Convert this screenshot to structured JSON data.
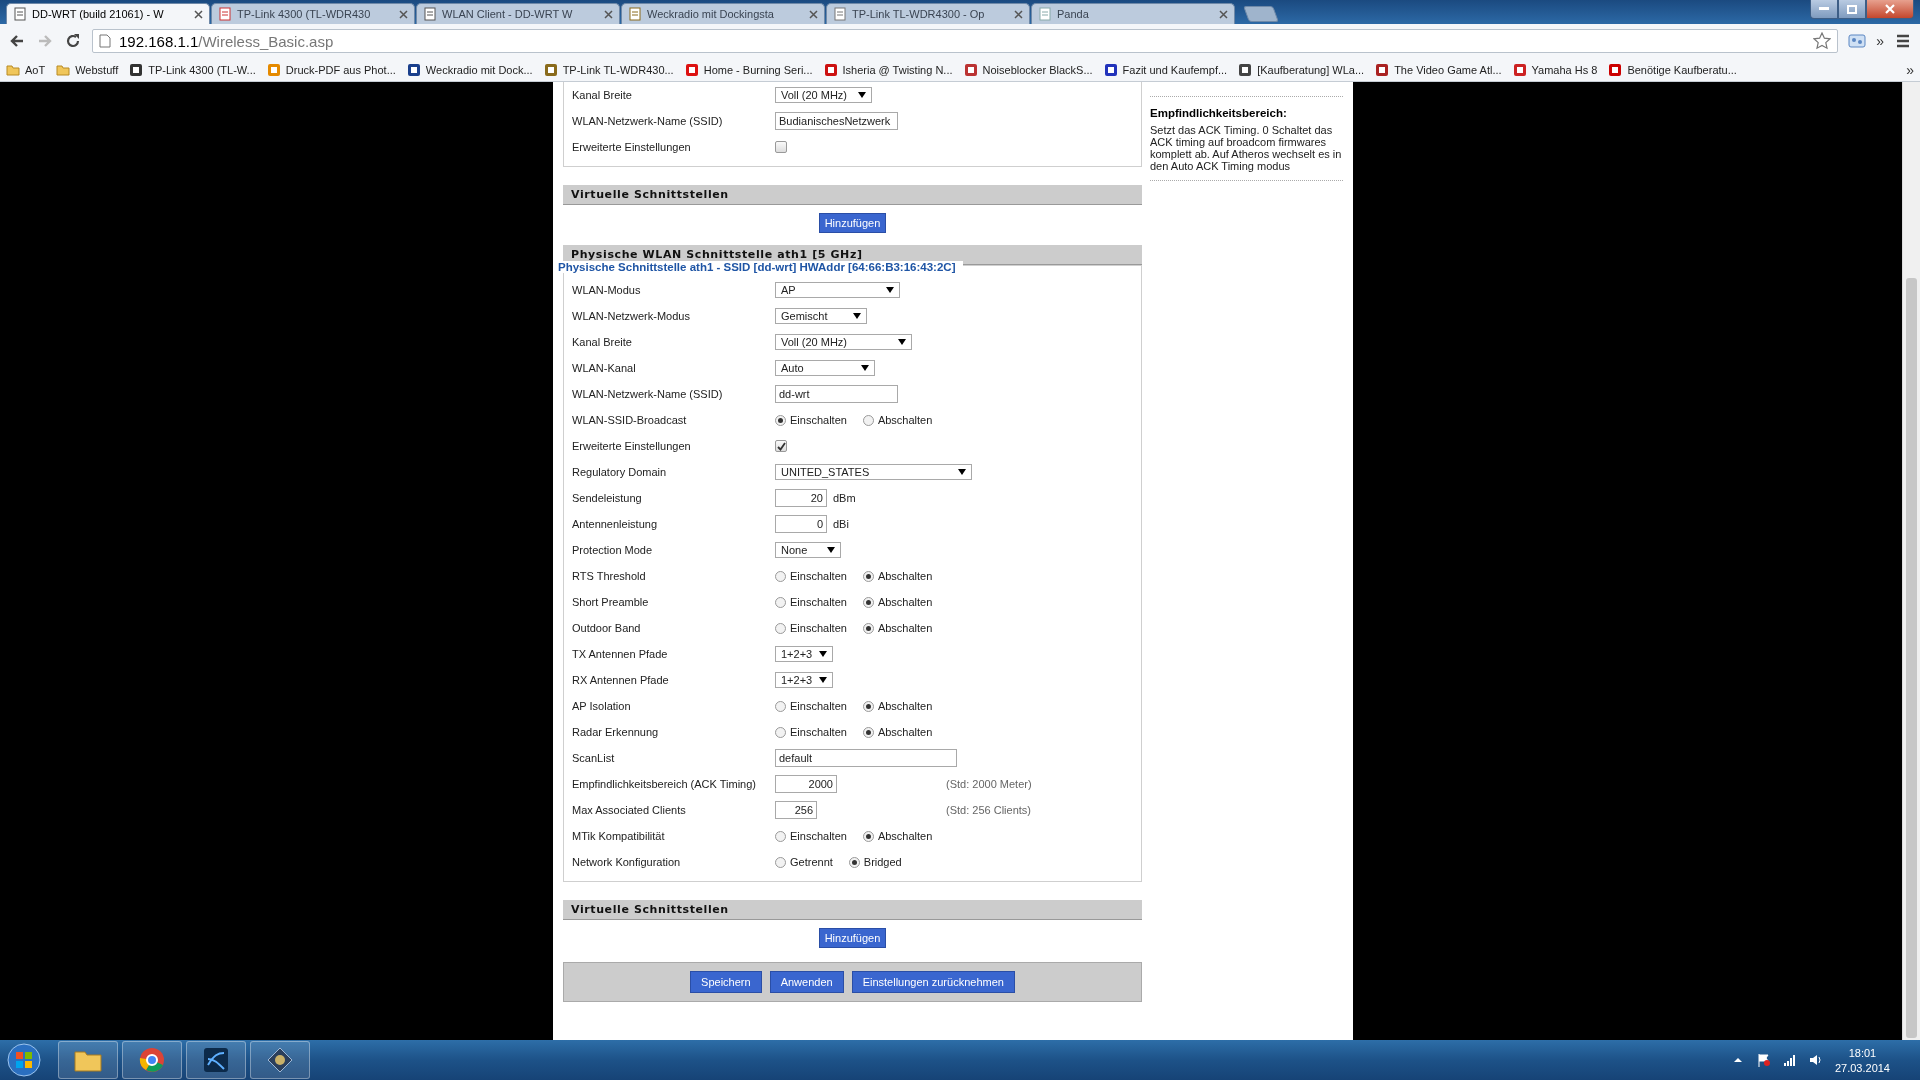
{
  "browser": {
    "tabs": [
      {
        "title": "DD-WRT (build 21061) - W",
        "selected": true
      },
      {
        "title": "TP-Link 4300 (TL-WDR430",
        "selected": false
      },
      {
        "title": "WLAN Client - DD-WRT W",
        "selected": false
      },
      {
        "title": "Weckradio mit Dockingsta",
        "selected": false
      },
      {
        "title": "TP-Link TL-WDR4300 - Op",
        "selected": false
      },
      {
        "title": "Panda",
        "selected": false
      }
    ],
    "address": {
      "host": "192.168.1.1",
      "path": "/Wireless_Basic.asp"
    },
    "toolbar_more": "»",
    "bookmarks": [
      {
        "label": "AoT",
        "kind": "folder"
      },
      {
        "label": "Webstuff",
        "kind": "folder"
      },
      {
        "label": "TP-Link 4300 (TL-W...",
        "kind": "site"
      },
      {
        "label": "Druck-PDF aus Phot...",
        "kind": "site"
      },
      {
        "label": "Weckradio mit Dock...",
        "kind": "site"
      },
      {
        "label": "TP-Link TL-WDR430...",
        "kind": "site"
      },
      {
        "label": "Home - Burning Seri...",
        "kind": "site"
      },
      {
        "label": "Isheria @ Twisting N...",
        "kind": "site"
      },
      {
        "label": "Noiseblocker BlackS...",
        "kind": "site"
      },
      {
        "label": "Fazit und Kaufempf...",
        "kind": "site"
      },
      {
        "label": "[Kaufberatung] WLa...",
        "kind": "site"
      },
      {
        "label": "The Video Game Atl...",
        "kind": "site"
      },
      {
        "label": "Yamaha Hs 8",
        "kind": "site"
      },
      {
        "label": "Benötige Kaufberatu...",
        "kind": "site"
      }
    ],
    "bookmarks_more": "»"
  },
  "content": [
    {
      "kind": "fieldset",
      "rows": [
        {
          "label": "Kanal Breite",
          "kind": "select",
          "value": "Voll (20 MHz)"
        },
        {
          "label": "WLAN-Netzwerk-Name (SSID)",
          "kind": "text",
          "value": "BudianischesNetzwerk"
        },
        {
          "label": "Erweiterte Einstellungen",
          "kind": "checkbox",
          "checked": false
        }
      ]
    },
    {
      "kind": "header",
      "title": "Virtuelle Schnittstellen"
    },
    {
      "kind": "add",
      "label": "Hinzufügen"
    },
    {
      "kind": "header",
      "title": "Physische WLAN Schnittstelle ath1 [5 GHz]"
    },
    {
      "kind": "fieldset",
      "legend": "Physische Schnittstelle ath1 - SSID [dd-wrt] HWAddr [64:66:B3:16:43:2C]",
      "rows": [
        {
          "label": "WLAN-Modus",
          "kind": "select",
          "value": "AP"
        },
        {
          "label": "WLAN-Netzwerk-Modus",
          "kind": "select",
          "value": "Gemischt"
        },
        {
          "label": "Kanal Breite",
          "kind": "select",
          "value": "Voll (20 MHz)"
        },
        {
          "label": "WLAN-Kanal",
          "kind": "select",
          "value": "Auto"
        },
        {
          "label": "WLAN-Netzwerk-Name (SSID)",
          "kind": "text",
          "value": "dd-wrt"
        },
        {
          "label": "WLAN-SSID-Broadcast",
          "kind": "radio",
          "options": [
            {
              "label": "Einschalten",
              "selected": true
            },
            {
              "label": "Abschalten",
              "selected": false
            }
          ]
        },
        {
          "label": "Erweiterte Einstellungen",
          "kind": "checkbox",
          "checked": true
        },
        {
          "label": "Regulatory Domain",
          "kind": "select",
          "value": "UNITED_STATES"
        },
        {
          "label": "Sendeleistung",
          "kind": "number",
          "value": "20",
          "unit": "dBm"
        },
        {
          "label": "Antennenleistung",
          "kind": "number",
          "value": "0",
          "unit": "dBi"
        },
        {
          "label": "Protection Mode",
          "kind": "select",
          "value": "None"
        },
        {
          "label": "RTS Threshold",
          "kind": "radio",
          "options": [
            {
              "label": "Einschalten",
              "selected": false
            },
            {
              "label": "Abschalten",
              "selected": true
            }
          ]
        },
        {
          "label": "Short Preamble",
          "kind": "radio",
          "options": [
            {
              "label": "Einschalten",
              "selected": false
            },
            {
              "label": "Abschalten",
              "selected": true
            }
          ]
        },
        {
          "label": "Outdoor Band",
          "kind": "radio",
          "options": [
            {
              "label": "Einschalten",
              "selected": false
            },
            {
              "label": "Abschalten",
              "selected": true
            }
          ]
        },
        {
          "label": "TX Antennen Pfade",
          "kind": "select",
          "value": "1+2+3"
        },
        {
          "label": "RX Antennen Pfade",
          "kind": "select",
          "value": "1+2+3"
        },
        {
          "label": "AP Isolation",
          "kind": "radio",
          "options": [
            {
              "label": "Einschalten",
              "selected": false
            },
            {
              "label": "Abschalten",
              "selected": true
            }
          ]
        },
        {
          "label": "Radar Erkennung",
          "kind": "radio",
          "options": [
            {
              "label": "Einschalten",
              "selected": false
            },
            {
              "label": "Abschalten",
              "selected": true
            }
          ]
        },
        {
          "label": "ScanList",
          "kind": "text",
          "value": "default"
        },
        {
          "label": "Empfindlichkeitsbereich (ACK Timing)",
          "kind": "number",
          "value": "2000",
          "hint": "(Std: 2000 Meter)"
        },
        {
          "label": "Max Associated Clients",
          "kind": "number",
          "value": "256",
          "hint": "(Std: 256 Clients)"
        },
        {
          "label": "MTik Kompatibilität",
          "kind": "radio",
          "options": [
            {
              "label": "Einschalten",
              "selected": false
            },
            {
              "label": "Abschalten",
              "selected": true
            }
          ]
        },
        {
          "label": "Network Konfiguration",
          "kind": "radio",
          "options": [
            {
              "label": "Getrennt",
              "selected": false
            },
            {
              "label": "Bridged",
              "selected": true
            }
          ]
        }
      ]
    },
    {
      "kind": "header",
      "title": "Virtuelle Schnittstellen"
    },
    {
      "kind": "add",
      "label": "Hinzufügen"
    }
  ],
  "actions": [
    "Speichern",
    "Anwenden",
    "Einstellungen zurücknehmen"
  ],
  "help": {
    "title": "Empfindlichkeitsbereich:",
    "text": "Setzt das ACK Timing. 0 Schaltet das ACK timing auf broadcom firmwares komplett ab. Auf Atheros wechselt es in den Auto ACK Timing modus"
  },
  "taskbar": {
    "time": "18:01",
    "date": "27.03.2014"
  }
}
